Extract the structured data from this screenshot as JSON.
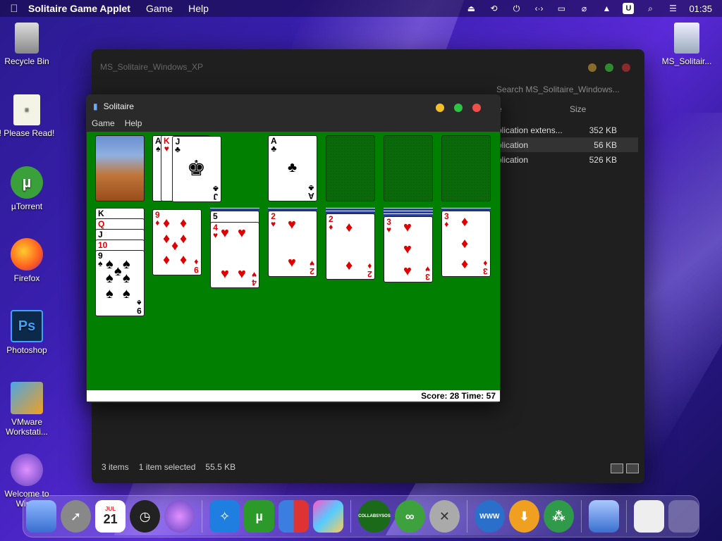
{
  "menubar": {
    "app_name": "Solitaire Game Applet",
    "menus": [
      "Game",
      "Help"
    ],
    "clock": "01:35",
    "status_icons": [
      "eject-icon",
      "sync-icon",
      "power-icon",
      "code-icon",
      "display-icon",
      "wifi-off-icon",
      "eject-triangle-icon",
      "u-badge",
      "search-icon",
      "control-center-icon"
    ],
    "u_badge": "U"
  },
  "desktop": {
    "icons": [
      {
        "label": "Recycle Bin",
        "icon": "recycle-bin-icon"
      },
      {
        "label": "! Please Read!",
        "icon": "notepad-icon"
      },
      {
        "label": "µTorrent",
        "icon": "utorrent-icon"
      },
      {
        "label": "Firefox",
        "icon": "firefox-icon"
      },
      {
        "label": "Photoshop",
        "icon": "photoshop-icon"
      },
      {
        "label": "VMware Workstati...",
        "icon": "vmware-icon"
      },
      {
        "label": "Welcome to Win...",
        "icon": "apple-icon"
      },
      {
        "label": "MS_Solitair...",
        "icon": "file-icon"
      }
    ]
  },
  "explorer": {
    "title": "MS_Solitaire_Windows_XP",
    "breadcrumb": "MS_Solitaire_Windows_XP",
    "search_placeholder": "Search MS_Solitaire_Windows...",
    "column_size": "Size",
    "column_type_fragment": "e",
    "rows": [
      {
        "type": "plication extens...",
        "size": "352 KB",
        "selected": false
      },
      {
        "type": "plication",
        "size": "56 KB",
        "selected": true
      },
      {
        "type": "plication",
        "size": "526 KB",
        "selected": false
      }
    ],
    "status_items": "3 items",
    "status_selected": "1 item selected",
    "status_size": "55.5 KB"
  },
  "solitaire": {
    "title": "Solitaire",
    "menu_game": "Game",
    "menu_help": "Help",
    "score_text": "Score: 28 Time: 57",
    "waste_cards": [
      "A♠",
      "K♥",
      "J♣"
    ],
    "foundation_top": {
      "rank": "A",
      "suit": "♣"
    },
    "tableau": [
      {
        "visible": [
          "K",
          "Q",
          "J",
          "10",
          "9♠"
        ]
      },
      {
        "top": {
          "rank": "9",
          "suit": "♦"
        }
      },
      {
        "top": {
          "rank": "4",
          "suit": "♥"
        },
        "under": "5♠"
      },
      {
        "top": {
          "rank": "2",
          "suit": "♥"
        }
      },
      {
        "top": {
          "rank": "2",
          "suit": "♦"
        }
      },
      {
        "top": {
          "rank": "3",
          "suit": "♥"
        }
      },
      {
        "top": {
          "rank": "3",
          "suit": "♦"
        }
      }
    ]
  },
  "dock": {
    "items": [
      "finder-icon",
      "launchpad-icon",
      "calendar-icon",
      "clock-icon",
      "apple-tv-icon",
      "safari-icon",
      "utorrent-icon",
      "windows-icon",
      "preview-icon",
      "collabsysos-icon",
      "link-icon",
      "tools-icon",
      "www-icon",
      "download-icon",
      "cluster-icon",
      "app-icon",
      "preview-window-icon",
      "trash-icon"
    ],
    "calendar_month": "JUL",
    "calendar_day": "21",
    "collab_label": "COLLABSYSOS",
    "www_label": "WWW"
  }
}
